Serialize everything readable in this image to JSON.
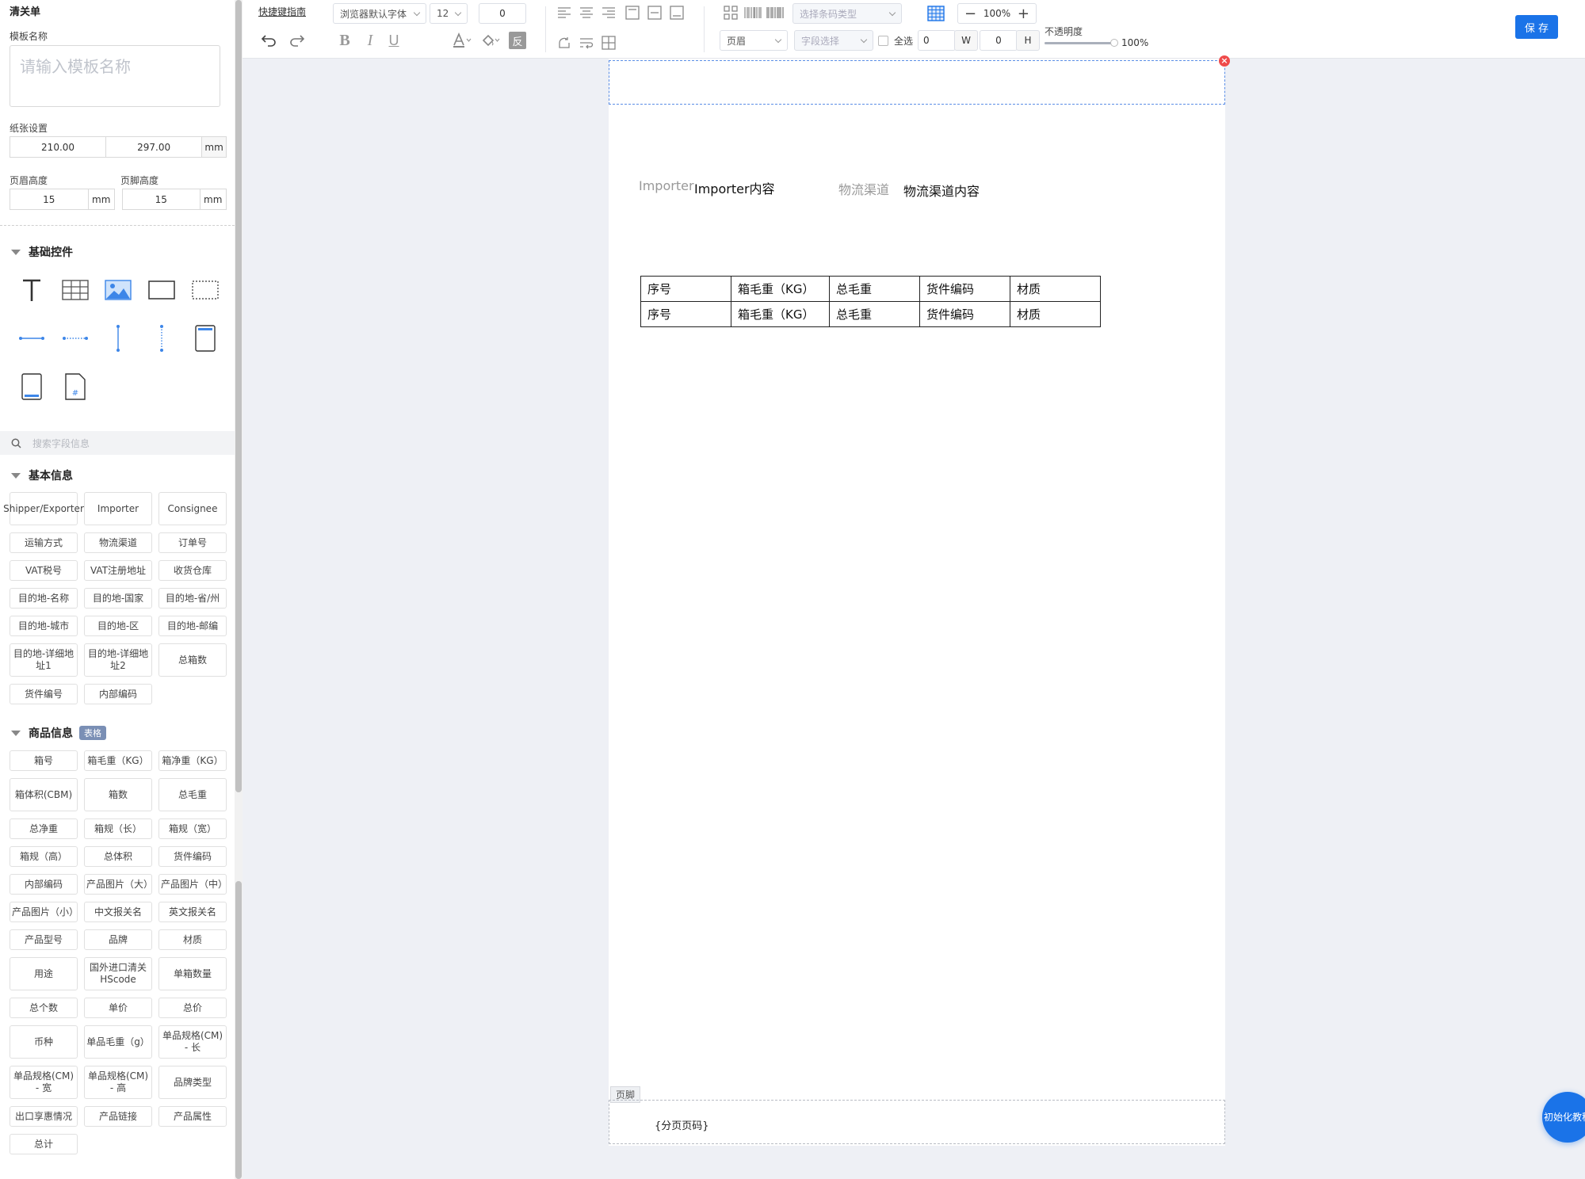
{
  "sidebar": {
    "title": "清关单",
    "template_name_label": "模板名称",
    "template_name_placeholder": "请输入模板名称",
    "paper_label": "纸张设置",
    "paper_width": "210.00",
    "paper_height": "297.00",
    "unit": "mm",
    "header_height_label": "页眉高度",
    "footer_height_label": "页脚高度",
    "header_height": "15",
    "footer_height": "15",
    "basic_controls_title": "基础控件",
    "search_placeholder": "搜索字段信息",
    "basic_info_title": "基本信息",
    "basic_info_fields": [
      "Shipper/Exporter",
      "Importer",
      "Consignee",
      "运输方式",
      "物流渠道",
      "订单号",
      "VAT税号",
      "VAT注册地址",
      "收货仓库",
      "目的地-名称",
      "目的地-国家",
      "目的地-省/州",
      "目的地-城市",
      "目的地-区",
      "目的地-邮编",
      "目的地-详细地址1",
      "目的地-详细地址2",
      "总箱数",
      "货件编号",
      "内部编码"
    ],
    "goods_info_title": "商品信息",
    "goods_info_badge": "表格",
    "goods_info_fields": [
      "箱号",
      "箱毛重（KG）",
      "箱净重（KG）",
      "箱体积(CBM)",
      "箱数",
      "总毛重",
      "总净重",
      "箱规（长）",
      "箱规（宽）",
      "箱规（高）",
      "总体积",
      "货件编码",
      "内部编码",
      "产品图片（大）",
      "产品图片（中）",
      "产品图片（小）",
      "中文报关名",
      "英文报关名",
      "产品型号",
      "品牌",
      "材质",
      "用途",
      "国外进口清关HScode",
      "单箱数量",
      "总个数",
      "单价",
      "总价",
      "币种",
      "单品毛重（g）",
      "单品规格(CM) - 长",
      "单品规格(CM) - 宽",
      "单品规格(CM) - 高",
      "品牌类型",
      "出口享惠情况",
      "产品链接",
      "产品属性",
      "总计"
    ]
  },
  "toolbar": {
    "shortcut_guide": "快捷键指南",
    "font_family": "浏览器默认字体",
    "font_size": "12",
    "letter_spacing": "0",
    "invert_label": "反",
    "barcode_type_placeholder": "选择条码类型",
    "zoom": "100%",
    "region_select": "页眉",
    "field_select_placeholder": "字段选择",
    "select_all_label": "全选",
    "width_value": "0",
    "width_label": "W",
    "height_value": "0",
    "height_label": "H",
    "opacity_label": "不透明度",
    "opacity_value": "100%",
    "opacity_fraction": 1.0,
    "save_label": "保 存"
  },
  "canvas": {
    "importer_label": "Importer",
    "importer_value": "Importer内容",
    "channel_label": "物流渠道",
    "channel_value": "物流渠道内容",
    "table_rows": [
      [
        "序号",
        "箱毛重（KG）",
        "总毛重",
        "货件编码",
        "材质"
      ],
      [
        "序号",
        "箱毛重（KG）",
        "总毛重",
        "货件编码",
        "材质"
      ]
    ],
    "footer_tag": "页脚",
    "footer_text": "{分页页码}",
    "close_glyph": "×"
  },
  "help_bubble": "初始化教程",
  "colors": {
    "accent": "#1a73e8",
    "badge": "#7a8fb5",
    "danger": "#ef4b4b",
    "canvas_bg": "#eef0f5"
  },
  "icons": {
    "basic_controls": [
      "text-icon",
      "table-icon",
      "image-icon",
      "rectangle-icon",
      "dashed-rectangle-icon",
      "horizontal-line-icon",
      "horizontal-dotted-line-icon",
      "vertical-line-icon",
      "vertical-dotted-line-icon",
      "page-icon",
      "page-footer-icon",
      "page-number-icon"
    ]
  }
}
